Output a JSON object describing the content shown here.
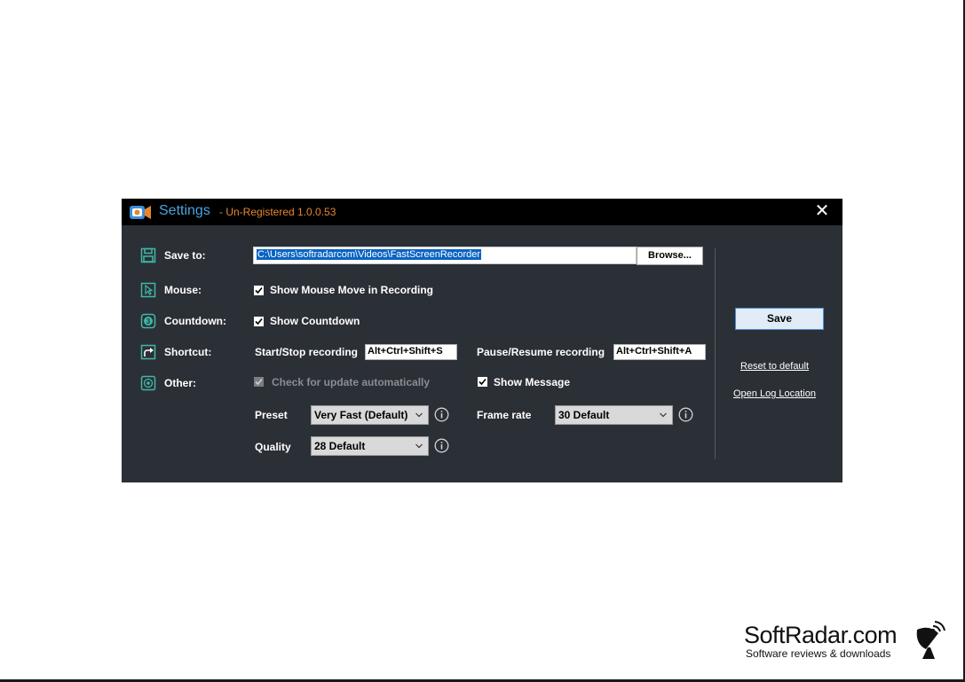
{
  "window": {
    "title": "Settings",
    "subtitle": "- Un-Registered 1.0.0.53",
    "close_glyph": "✕"
  },
  "categories": {
    "save_to": {
      "label": "Save to:",
      "icon": "save-icon"
    },
    "mouse": {
      "label": "Mouse:",
      "icon": "cursor-icon"
    },
    "countdown": {
      "label": "Countdown:",
      "icon": "countdown-icon"
    },
    "shortcut": {
      "label": "Shortcut:",
      "icon": "shortcut-arrow-icon"
    },
    "other": {
      "label": "Other:",
      "icon": "target-icon"
    }
  },
  "save_to": {
    "path": "C:\\Users\\softradarcom\\Videos\\FastScreenRecorder",
    "browse_label": "Browse..."
  },
  "mouse": {
    "show_mouse_move": {
      "label": "Show Mouse Move in Recording",
      "checked": true
    }
  },
  "countdown": {
    "show_countdown": {
      "label": "Show Countdown",
      "checked": true
    }
  },
  "shortcut": {
    "start_stop_label": "Start/Stop recording",
    "start_stop_value": "Alt+Ctrl+Shift+S",
    "pause_resume_label": "Pause/Resume recording",
    "pause_resume_value": "Alt+Ctrl+Shift+A"
  },
  "other": {
    "check_update": {
      "label": "Check for update automatically",
      "checked": true,
      "disabled": true
    },
    "show_message": {
      "label": "Show Message",
      "checked": true
    }
  },
  "encoding": {
    "preset_label": "Preset",
    "preset_value": "Very Fast (Default)",
    "frame_rate_label": "Frame rate",
    "frame_rate_value": "30 Default",
    "quality_label": "Quality",
    "quality_value": "28 Default"
  },
  "actions": {
    "save_label": "Save",
    "reset_label": "Reset to default",
    "open_log_label": "Open Log Location"
  },
  "watermark": {
    "name": "SoftRadar.com",
    "tagline": "Software reviews & downloads"
  },
  "colors": {
    "window_bg": "#2b2f36",
    "titlebar_bg": "#000000",
    "title": "#4aa3df",
    "subtitle": "#e8862e",
    "icon_accent": "#3fb8a8",
    "selection": "#0a64c2"
  }
}
